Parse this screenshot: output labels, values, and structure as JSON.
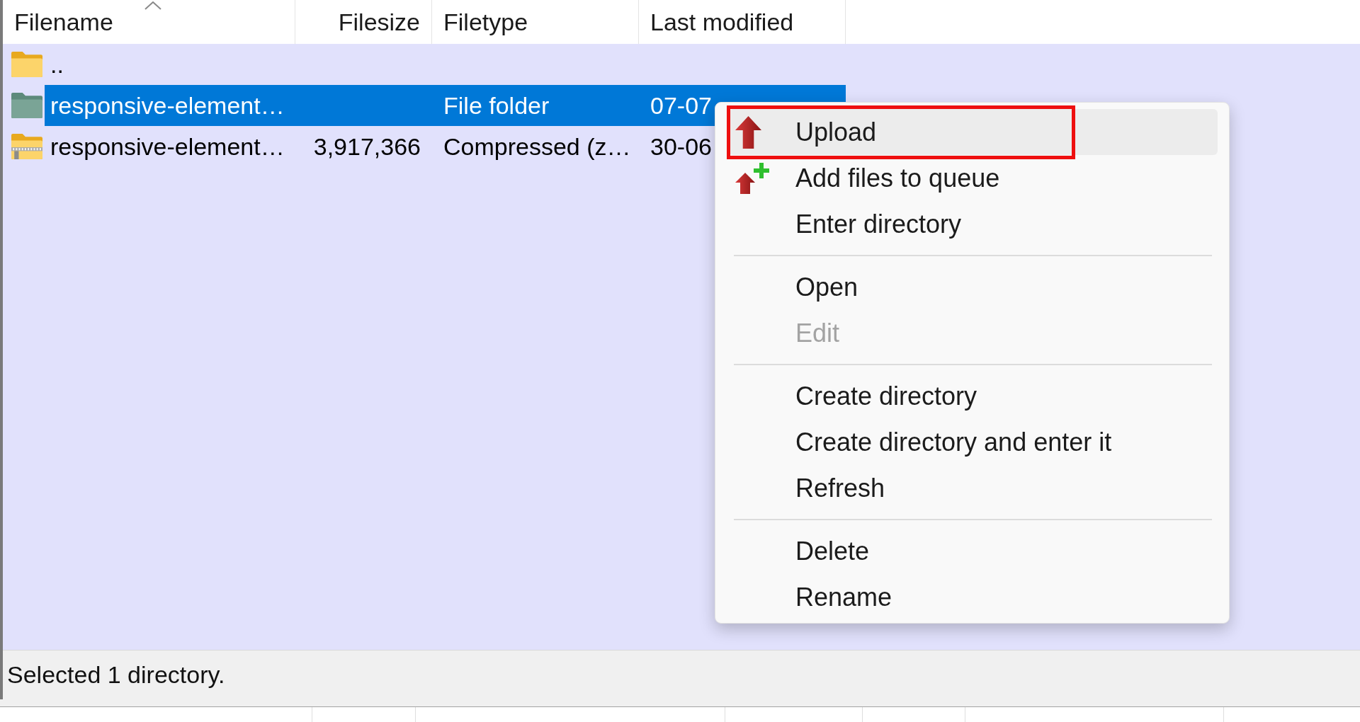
{
  "file_list": {
    "columns": [
      {
        "label": "Filename",
        "sorted": true
      },
      {
        "label": "Filesize",
        "sorted": false
      },
      {
        "label": "Filetype",
        "sorted": false
      },
      {
        "label": "Last modified",
        "sorted": false
      }
    ],
    "rows": [
      {
        "kind": "folder",
        "filename": "..",
        "selected": false
      },
      {
        "kind": "folder",
        "filename": "responsive-element…",
        "filetype": "File folder",
        "last_modified": "07-07",
        "selected": true
      },
      {
        "kind": "archive",
        "filename": "responsive-element…",
        "filesize": "3,917,366",
        "filetype": "Compressed (z…",
        "last_modified": "30-06",
        "selected": false
      }
    ]
  },
  "context_menu": {
    "groups": [
      [
        {
          "label": "Upload",
          "kind": "upload",
          "selected": true,
          "outlined": true,
          "disabled": false
        },
        {
          "label": "Add files to queue",
          "kind": "enqueue",
          "selected": false,
          "outlined": false,
          "disabled": false
        },
        {
          "label": "Enter directory",
          "kind": "plain",
          "selected": false,
          "outlined": false,
          "disabled": false
        }
      ],
      [
        {
          "label": "Open",
          "kind": "plain",
          "selected": false,
          "outlined": false,
          "disabled": false
        },
        {
          "label": "Edit",
          "kind": "plain",
          "selected": false,
          "outlined": false,
          "disabled": true
        }
      ],
      [
        {
          "label": "Create directory",
          "kind": "plain",
          "selected": false,
          "outlined": false,
          "disabled": false
        },
        {
          "label": "Create directory and enter it",
          "kind": "plain",
          "selected": false,
          "outlined": false,
          "disabled": false
        },
        {
          "label": "Refresh",
          "kind": "plain",
          "selected": false,
          "outlined": false,
          "disabled": false
        }
      ],
      [
        {
          "label": "Delete",
          "kind": "plain",
          "selected": false,
          "outlined": false,
          "disabled": false
        },
        {
          "label": "Rename",
          "kind": "plain",
          "selected": false,
          "outlined": false,
          "disabled": false
        }
      ]
    ]
  },
  "status_bar": {
    "text": "Selected 1 directory."
  }
}
